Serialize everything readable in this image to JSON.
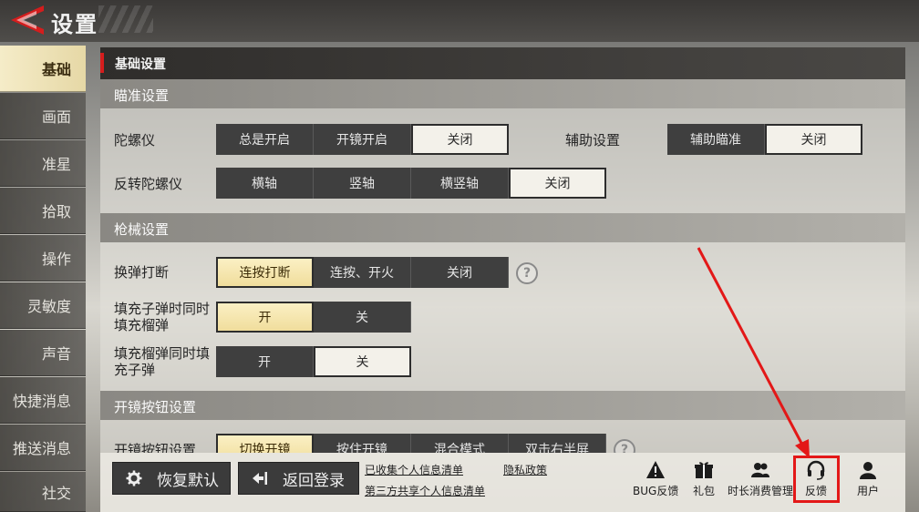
{
  "header": {
    "title": "设置"
  },
  "sidebar": {
    "items": [
      {
        "label": "基础",
        "active": true
      },
      {
        "label": "画面"
      },
      {
        "label": "准星"
      },
      {
        "label": "拾取"
      },
      {
        "label": "操作"
      },
      {
        "label": "灵敏度"
      },
      {
        "label": "声音"
      },
      {
        "label": "快捷消息"
      },
      {
        "label": "推送消息"
      },
      {
        "label": "社交"
      }
    ]
  },
  "main": {
    "header": "基础设置",
    "sections": {
      "aim": {
        "title": "瞄准设置",
        "gyro": {
          "label": "陀螺仪",
          "options": [
            "总是开启",
            "开镜开启",
            "关闭"
          ],
          "selected": "关闭"
        },
        "assist": {
          "label": "辅助设置",
          "options": [
            "辅助瞄准",
            "关闭"
          ],
          "selected": "关闭"
        },
        "invert_gyro": {
          "label": "反转陀螺仪",
          "options": [
            "横轴",
            "竖轴",
            "横竖轴",
            "关闭"
          ],
          "selected": "关闭"
        }
      },
      "gun": {
        "title": "枪械设置",
        "reload_interrupt": {
          "label": "换弹打断",
          "options": [
            "连按打断",
            "连按、开火",
            "关闭"
          ],
          "selected": "连按打断"
        },
        "fill_bullets": {
          "label": "填充子弹时同时填充榴弹",
          "options": [
            "开",
            "关"
          ],
          "selected": "开"
        },
        "fill_grenades": {
          "label": "填充榴弹同时填充子弹",
          "options": [
            "开",
            "关"
          ],
          "selected": "关"
        }
      },
      "scope": {
        "title": "开镜按钮设置",
        "scope_button": {
          "label": "开镜按钮设置",
          "options": [
            "切换开镜",
            "按住开镜",
            "混合模式",
            "双击右半屏"
          ],
          "selected": "切换开镜"
        }
      }
    }
  },
  "bottom": {
    "restore_label": "恢复默认",
    "logout_label": "返回登录",
    "links": {
      "collected_info": "已收集个人信息清单",
      "privacy": "隐私政策",
      "third_party": "第三方共享个人信息清单"
    },
    "tools": [
      {
        "label": "BUG反馈",
        "icon": "warning-icon"
      },
      {
        "label": "礼包",
        "icon": "gift-icon"
      },
      {
        "label": "时长消费管理",
        "icon": "users-icon"
      },
      {
        "label": "反馈",
        "icon": "headset-icon"
      },
      {
        "label": "用户",
        "icon": "user-icon"
      }
    ]
  },
  "colors": {
    "accent_red": "#d41d1d",
    "highlight": "#e31818",
    "selected_yellow": "#f0dd9c"
  }
}
